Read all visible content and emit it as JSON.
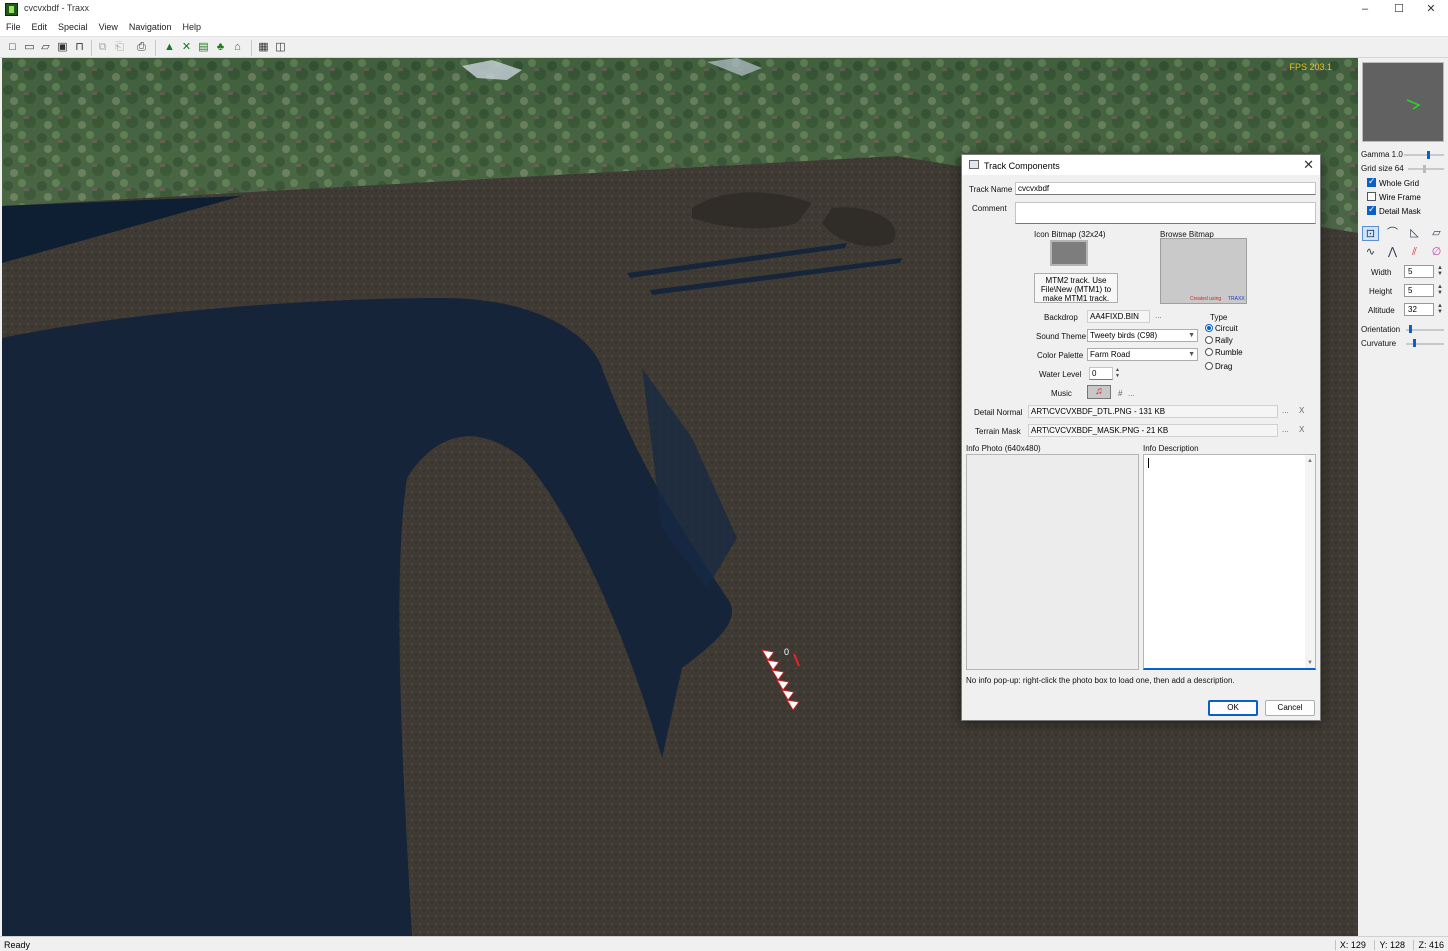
{
  "window": {
    "title": "cvcvxbdf - Traxx",
    "minimize": "–",
    "maximize": "☐",
    "close": "✕"
  },
  "menu": [
    "File",
    "Edit",
    "Special",
    "View",
    "Navigation",
    "Help"
  ],
  "viewport": {
    "fps": "FPS 203.1",
    "marker_label": "0"
  },
  "right_panel": {
    "gamma_label": "Gamma 1.0",
    "gamma_level": 0.6,
    "grid_label": "Grid size 64",
    "grid_level": 0.45,
    "whole_grid": "Whole Grid",
    "wire_frame": "Wire Frame",
    "detail_mask": "Detail Mask",
    "width_label": "Width",
    "width_value": "5",
    "height_label": "Height",
    "height_value": "5",
    "altitude_label": "Altitude",
    "altitude_value": "32",
    "orientation_label": "Orientation",
    "orientation_level": 0.1,
    "curvature_label": "Curvature",
    "curvature_level": 0.2
  },
  "dialog": {
    "title": "Track Components",
    "track_name_label": "Track Name",
    "track_name": "cvcvxbdf",
    "comment_label": "Comment",
    "comment": "",
    "icon_bitmap_label": "Icon Bitmap (32x24)",
    "browse_bitmap_label": "Browse Bitmap",
    "mtm_note": "MTM2 track. Use File\\New (MTM1) to make MTM1 track.",
    "created_text": "Created using",
    "traxx_text": "TRAXX",
    "backdrop_label": "Backdrop",
    "backdrop_value": "AA4FIXD.BIN",
    "sound_theme_label": "Sound Theme",
    "sound_theme_value": "Tweety birds (C98)",
    "color_palette_label": "Color Palette",
    "color_palette_value": "Farm Road",
    "water_level_label": "Water Level",
    "water_level_value": "0",
    "music_label": "Music",
    "music_hash": "#",
    "type_label": "Type",
    "type_options": [
      "Circuit",
      "Rally",
      "Rumble",
      "Drag"
    ],
    "detail_normal_label": "Detail Normal",
    "detail_normal_value": "ART\\CVCVXBDF_DTL.PNG  -  131 KB",
    "terrain_mask_label": "Terrain Mask",
    "terrain_mask_value": "ART\\CVCVXBDF_MASK.PNG  -  21 KB",
    "info_photo_label": "Info Photo (640x480)",
    "info_description_label": "Info Description",
    "info_note": "No info pop-up: right-click the photo box to load one, then add a description.",
    "ok": "OK",
    "cancel": "Cancel",
    "dots": "...",
    "x": "X"
  },
  "status": {
    "text": "Ready",
    "x": "X: 129",
    "y": "Y: 128",
    "z": "Z: 416"
  }
}
